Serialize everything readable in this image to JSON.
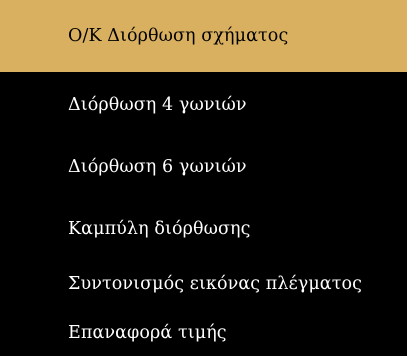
{
  "menu": {
    "selected_index": 0,
    "items": [
      {
        "label": "Ο/Κ Διόρθωση σχήματος"
      },
      {
        "label": "Διόρθωση 4 γωνιών"
      },
      {
        "label": "Διόρθωση 6 γωνιών"
      },
      {
        "label": "Καμπύλη διόρθωσης"
      },
      {
        "label": "Συντονισμός εικόνας πλέγματος"
      },
      {
        "label": "Επαναφορά τιμής"
      }
    ]
  },
  "colors": {
    "background": "#000000",
    "highlight": "#d9b060",
    "text": "#ffffff",
    "selected_text": "#000000"
  }
}
